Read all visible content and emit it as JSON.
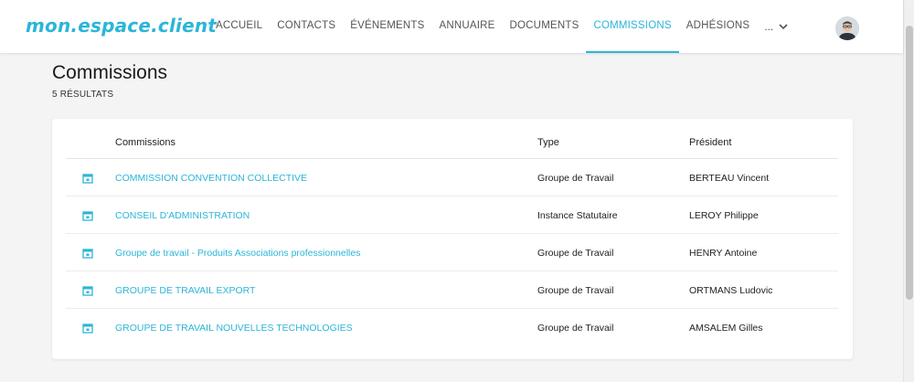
{
  "brand": {
    "logo_text": "mon.espace.client",
    "accent_color": "#2cb5d8"
  },
  "nav": {
    "items": [
      {
        "label": "ACCUEIL"
      },
      {
        "label": "CONTACTS"
      },
      {
        "label": "ÉVÉNEMENTS"
      },
      {
        "label": "ANNUAIRE"
      },
      {
        "label": "DOCUMENTS"
      },
      {
        "label": "COMMISSIONS",
        "active": true
      },
      {
        "label": "ADHÉSIONS"
      }
    ],
    "more_label": "...",
    "more_icon": "chevron-down-icon"
  },
  "user": {
    "avatar_icon": "user-avatar"
  },
  "page": {
    "title": "Commissions",
    "results_label": "5 RÉSULTATS"
  },
  "table": {
    "headers": {
      "name": "Commissions",
      "type": "Type",
      "president": "Président"
    },
    "row_icon": "calendar-icon",
    "rows": [
      {
        "name": "COMMISSION CONVENTION COLLECTIVE",
        "type": "Groupe de Travail",
        "president": "BERTEAU Vincent"
      },
      {
        "name": "CONSEIL D'ADMINISTRATION",
        "type": "Instance Statutaire",
        "president": "LEROY Philippe"
      },
      {
        "name": "Groupe de travail - Produits Associations professionnelles",
        "type": "Groupe de Travail",
        "president": "HENRY Antoine"
      },
      {
        "name": "GROUPE DE TRAVAIL EXPORT",
        "type": "Groupe de Travail",
        "president": "ORTMANS Ludovic"
      },
      {
        "name": "GROUPE DE TRAVAIL NOUVELLES TECHNOLOGIES",
        "type": "Groupe de Travail",
        "president": "AMSALEM Gilles"
      }
    ]
  }
}
